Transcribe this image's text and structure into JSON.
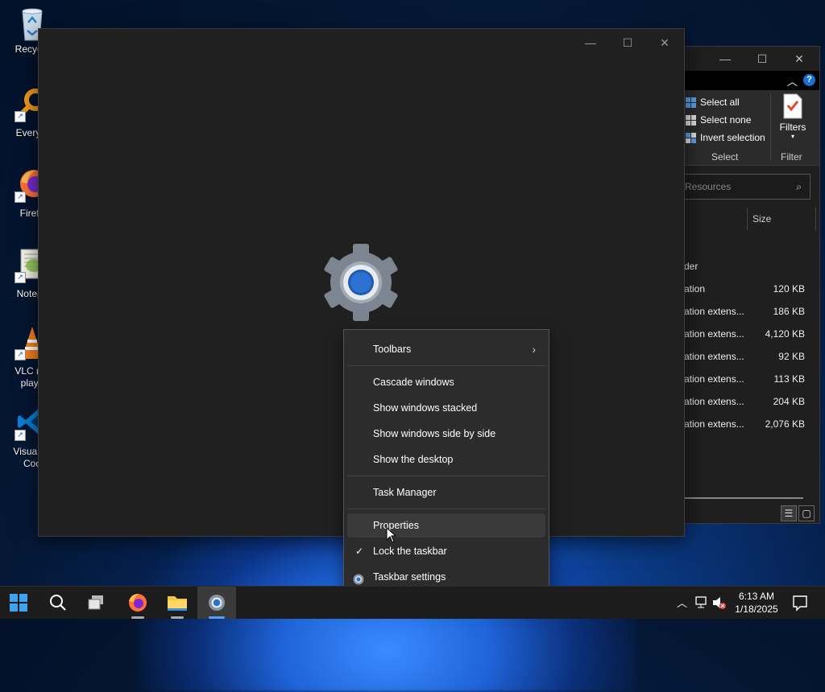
{
  "desktop": {
    "icons": [
      {
        "label": "Recycle",
        "icon": "recycle-bin-icon"
      },
      {
        "label": "Everyth",
        "icon": "everything-search-icon"
      },
      {
        "label": "Firefo",
        "icon": "firefox-icon"
      },
      {
        "label": "Notepa",
        "icon": "notepad-plus-plus-icon"
      },
      {
        "label": "VLC me\nplaye",
        "icon": "vlc-cone-icon"
      },
      {
        "label": "Visual St\nCod",
        "icon": "vscode-icon"
      }
    ]
  },
  "explorer": {
    "ribbon": {
      "select_all": "Select all",
      "select_none": "Select none",
      "invert_selection": "Invert selection",
      "filters": "Filters",
      "group_select": "Select",
      "group_filter": "Filter"
    },
    "search_placeholder": "Resources",
    "size_header": "Size",
    "rows": [
      {
        "name": "der",
        "size": ""
      },
      {
        "name": "ation",
        "size": "120 KB"
      },
      {
        "name": "ation extens...",
        "size": "186 KB"
      },
      {
        "name": "ation extens...",
        "size": "4,120 KB"
      },
      {
        "name": "ation extens...",
        "size": "92 KB"
      },
      {
        "name": "ation extens...",
        "size": "113 KB"
      },
      {
        "name": "ation extens...",
        "size": "204 KB"
      },
      {
        "name": "ation extens...",
        "size": "2,076 KB"
      }
    ]
  },
  "settings_window": {
    "icon": "settings-gear-icon"
  },
  "context_menu": {
    "toolbars": "Toolbars",
    "cascade": "Cascade windows",
    "stacked": "Show windows stacked",
    "side_by_side": "Show windows side by side",
    "show_desktop": "Show the desktop",
    "task_manager": "Task Manager",
    "properties": "Properties",
    "lock_taskbar": "Lock the taskbar",
    "taskbar_settings": "Taskbar settings"
  },
  "taskbar": {
    "time": "6:13 AM",
    "date": "1/18/2025"
  },
  "colors": {
    "accent": "#1a6fd6",
    "menu_bg": "#2c2c2c",
    "window_bg": "#202020"
  }
}
